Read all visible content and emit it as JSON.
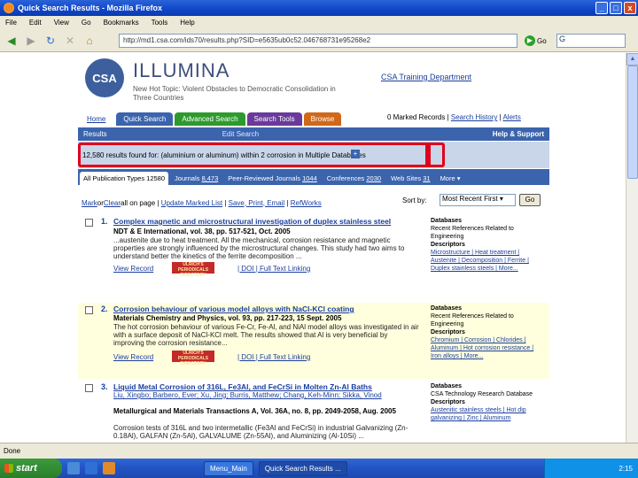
{
  "window": {
    "title": "Quick Search Results - Mozilla Firefox",
    "btn_min": "_",
    "btn_max": "□",
    "btn_close": "x"
  },
  "menu": [
    "File",
    "Edit",
    "View",
    "Go",
    "Bookmarks",
    "Tools",
    "Help"
  ],
  "nav": {
    "url": "http://md1.csa.com/ids70/results.php?SID=e5635ub0c52.046768731e95268e2",
    "go": "Go",
    "go_icon": "▶",
    "search_value": "G"
  },
  "brand": {
    "logo": "CSA",
    "name": "ILLUMINA",
    "hot_topic": "New Hot Topic: Violent Obstacles to Democratic Consolidation in Three Countries",
    "training": "CSA Training Department"
  },
  "tabs": {
    "home": "Home",
    "quick": "Quick Search",
    "advanced": "Advanced Search",
    "tools": "Search Tools",
    "browse": "Browse",
    "marked": "0 Marked Records",
    "sep": " | ",
    "history": "Search History",
    "alerts": "Alerts"
  },
  "bar": {
    "results": "Results",
    "modify": "Edit Search",
    "help": "Help & Support"
  },
  "summary": {
    "text": "12,580 results found for: (aluminium or aluminum) within 2 corrosion in Multiple Databases",
    "plus": "+"
  },
  "pubtabs": [
    {
      "label": "All Publication Types",
      "count": "12580",
      "active": true
    },
    {
      "label": "Journals",
      "count": "8,473",
      "active": false
    },
    {
      "label": "Peer-Reviewed Journals",
      "count": "1044",
      "active": false
    },
    {
      "label": "Conferences",
      "count": "2030",
      "active": false
    },
    {
      "label": "Web Sites",
      "count": "31",
      "active": false
    },
    {
      "label": "More",
      "count": "",
      "active": false
    }
  ],
  "tools": {
    "mark": "Mark",
    "or": " or ",
    "clear": "Clear",
    "all": " all on page",
    "update": "Update Marked List",
    "save": "Save, Print, Email",
    "refworks": "RefWorks",
    "sortby": "Sort by:",
    "sort_value": "Most Recent First",
    "go": "Go"
  },
  "results": [
    {
      "num": "1.",
      "title": "Complex magnetic and microstructural investigation of duplex stainless steel",
      "source": "NDT & E International, vol. 38, pp. 517-521, Oct. 2005",
      "abstract": "...austenite due to heat treatment. All the mechanical, corrosion resistance and magnetic properties are strongly influenced by the microstructural changes. This study had two aims to understand better the kinetics of the ferrite decomposition ...",
      "view": "View Record",
      "ulrich": "ULRICH'S PERIODICALS DIRECTORY",
      "links": "| DOI  |  Full Text Linking",
      "side_db": "Databases",
      "side_dbv": "Recent References Related to Engineering",
      "side_desc": "Descriptors",
      "side_links": "Microstructure | Heat treatment | Austenite | Decomposition | Ferrite | Duplex stainless steels | More..."
    },
    {
      "num": "2.",
      "title": "Corrosion behaviour of various model alloys with NaCl-KCl coating",
      "source": "Materials Chemistry and Physics, vol. 93, pp. 217-223, 15 Sept. 2005",
      "abstract": "The hot corrosion behaviour of various Fe-Cr, Fe-Al, and NiAl model alloys was investigated in air with a surface deposit of NaCl-KCl melt. The results showed that Al is very beneficial by improving the corrosion resistance...",
      "view": "View Record",
      "ulrich": "ULRICH'S PERIODICALS DIRECTORY",
      "links": "| DOI  |  Full Text Linking",
      "side_db": "Databases",
      "side_dbv": "Recent References Related to Engineering",
      "side_desc": "Descriptors",
      "side_links": "Chromium | Corrosion | Chlorides | Aluminum | Hot corrosion resistance | Iron alloys | More..."
    },
    {
      "num": "3.",
      "title": "Liquid Metal Corrosion of 316L, Fe3Al, and FeCrSi in Molten Zn-Al Baths",
      "authors": "Liu, Xingbo; Barbero, Ever; Xu, Jing; Burris, Matthew; Chang, Keh-Minn; Sikka, Vinod",
      "source": "Metallurgical and Materials Transactions A, Vol. 36A, no. 8, pp. 2049-2058, Aug. 2005",
      "abstract": "Corrosion tests of 316L and two intermetallic (Fe3Al and FeCrSi) in industrial Galvanizing (Zn-0.18Al), GALFAN (Zn-5Al), GALVALUME (Zn-55Al), and Aluminizing (Al-10Si) ...",
      "side_db": "Databases",
      "side_dbv": "CSA Technology Research Database",
      "side_desc": "Descriptors",
      "side_links": "Austenitic stainless steels | Hot dip galvanizing | Zinc | Aluminum"
    }
  ],
  "status": "Done",
  "taskbar": {
    "start": "start",
    "items": [
      "Menu_Main",
      "Quick Search Results ..."
    ],
    "clock": "2:15"
  }
}
